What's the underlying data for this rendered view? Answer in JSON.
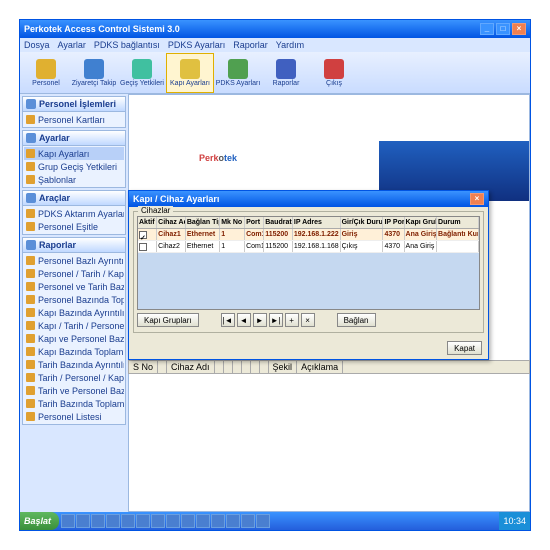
{
  "window": {
    "title": "Perkotek Access Control Sistemi 3.0"
  },
  "menubar": [
    "Dosya",
    "Ayarlar",
    "PDKS bağlantısı",
    "PDKS Ayarları",
    "Raporlar",
    "Yardım"
  ],
  "toolbar": [
    {
      "label": "Personel",
      "color": "#e0b030"
    },
    {
      "label": "Ziyaretçi Takip",
      "color": "#4080d0"
    },
    {
      "label": "Geçiş Yetkileri",
      "color": "#40c0a0"
    },
    {
      "label": "Kapı Ayarları",
      "color": "#e0c040",
      "selected": true
    },
    {
      "label": "PDKS Ayarları",
      "color": "#50a050"
    },
    {
      "label": "Raporlar",
      "color": "#4060c0"
    },
    {
      "label": "Çıkış",
      "color": "#d04040"
    }
  ],
  "sidebar": [
    {
      "title": "Personel İşlemleri",
      "items": [
        "Personel Kartları"
      ]
    },
    {
      "title": "Ayarlar",
      "items": [
        "Kapı Ayarları",
        "Grup Geçiş Yetkileri",
        "Şablonlar"
      ],
      "selected": 0
    },
    {
      "title": "Araçlar",
      "items": [
        "PDKS Aktarım Ayarları",
        "Personel Eşitle"
      ]
    },
    {
      "title": "Raporlar",
      "items": [
        "Personel Bazlı Ayrıntılı Geçiş Raporu",
        "Personel / Tarih / Kapı Bazında Gir...",
        "Personel ve Tarih Bazında Ayrıntılı ...",
        "Personel Bazında Toplam Geçiş Ra...",
        "Kapı Bazında Ayrıntılı Rapor",
        "Kapı / Tarih / Personel Bazında To...",
        "Kapı ve Personel Bazında Toplam ...",
        "Kapı Bazında Toplam Geçiş Raporu",
        "Tarih Bazında Ayrıntılı Rapor",
        "Tarih / Personel / Kapı Bazında To...",
        "Tarih ve Personel Bazında Toplam ...",
        "Tarih Bazında Toplam Geçiş Raporu",
        "Personel Listesi"
      ]
    }
  ],
  "logo": {
    "p1": "Perk",
    "p2": "o",
    "p3": "tek"
  },
  "dialog": {
    "title": "Kapı / Cihaz Ayarları",
    "group": "Cihazlar",
    "columns": [
      "Aktif",
      "Cihaz Adı",
      "Bağlan Tipi",
      "Mk No",
      "Port",
      "Baudrate",
      "IP Adres",
      "Gir/Çık Durum",
      "IP Port",
      "Kapı Grubu",
      "Durum"
    ],
    "widths": [
      20,
      30,
      36,
      26,
      20,
      30,
      50,
      45,
      22,
      34,
      44
    ],
    "rows": [
      {
        "sel": true,
        "cells": [
          "on",
          "Cihaz1",
          "Ethernet",
          "1",
          "Com1",
          "115200",
          "192.168.1.222",
          "Giriş",
          "4370",
          "Ana Giriş",
          "Bağlantı Kuruldu"
        ]
      },
      {
        "sel": false,
        "cells": [
          "off",
          "Cihaz2",
          "Ethernet",
          "1",
          "Com1",
          "115200",
          "192.168.1.168",
          "Çıkış",
          "4370",
          "Ana Giriş",
          ""
        ]
      }
    ],
    "btn_groups": "Kapı Grupları",
    "btn_connect": "Bağlan",
    "btn_close": "Kapat",
    "nav": [
      "|◄",
      "◄",
      "►",
      "►|",
      "+",
      "×"
    ]
  },
  "under_cols": [
    "S No",
    "",
    "Cihaz Adı",
    "",
    "",
    "",
    "",
    "",
    "",
    "Şekil",
    "Açıklama"
  ],
  "taskbar": {
    "start": "Başlat",
    "time": "10:34"
  }
}
